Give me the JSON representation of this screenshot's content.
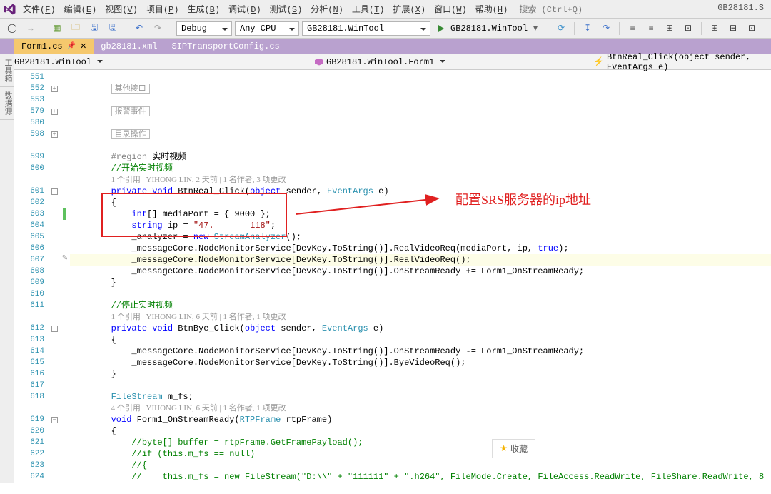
{
  "menubar": {
    "items": [
      "文件(F)",
      "编辑(E)",
      "视图(V)",
      "项目(P)",
      "生成(B)",
      "调试(D)",
      "测试(S)",
      "分析(N)",
      "工具(T)",
      "扩展(X)",
      "窗口(W)",
      "帮助(H)"
    ],
    "search_placeholder": "搜索 (Ctrl+Q)",
    "solution_title": "GB28181.S"
  },
  "toolbar": {
    "config": "Debug",
    "platform": "Any CPU",
    "startup": "GB28181.WinTool",
    "run": "GB28181.WinTool"
  },
  "tabs": [
    {
      "label": "Form1.cs",
      "active": true,
      "pinned": true
    },
    {
      "label": "gb28181.xml",
      "active": false
    },
    {
      "label": "SIPTransportConfig.cs",
      "active": false
    }
  ],
  "crumbs": {
    "left": "GB28181.WinTool",
    "center": "GB28181.WinTool.Form1",
    "right": "BtnReal_Click(object sender, EventArgs e)"
  },
  "sidetabs": [
    "工具箱",
    "数据源"
  ],
  "code": {
    "lines": [
      {
        "n": "551",
        "fold": "",
        "t": "                "
      },
      {
        "n": "552",
        "fold": "box+",
        "t": "        <span class='bx'>其他接口</span>"
      },
      {
        "n": "553",
        "fold": "",
        "t": ""
      },
      {
        "n": "579",
        "fold": "box+",
        "t": "        <span class='bx'>报警事件</span>"
      },
      {
        "n": "580",
        "fold": "",
        "t": ""
      },
      {
        "n": "598",
        "fold": "box+",
        "t": "        <span class='bx'>目录操作</span>"
      },
      {
        "n": "",
        "fold": "",
        "t": ""
      },
      {
        "n": "599",
        "fold": "",
        "t": "        <span class='reg'>#region</span> 实时视频"
      },
      {
        "n": "600",
        "fold": "",
        "t": "        <span class='cm'>//开始实时视频</span>"
      },
      {
        "n": "",
        "fold": "",
        "t": "        <span class='ref'>1 个引用 | YIHONG LIN, 2 天前 | 1 名作者, 3 项更改</span>"
      },
      {
        "n": "601",
        "fold": "box-",
        "t": "        <span class='kw'>private</span> <span class='kw'>void</span> BtnReal_Click(<span class='kw'>object</span> sender, <span class='tp'>EventArgs</span> e)"
      },
      {
        "n": "602",
        "fold": "",
        "t": "        {"
      },
      {
        "n": "603",
        "fold": "",
        "ind": "green",
        "t": "            <span class='kw'>int</span>[] mediaPort = { 9000 };"
      },
      {
        "n": "604",
        "fold": "",
        "t": "            <span class='kw'>string</span> ip = <span class='str'>\"47.       118\"</span>;"
      },
      {
        "n": "605",
        "fold": "",
        "t": "            _analyzer = <span class='kw'>new</span> <span class='tp'>StreamAnalyzer</span>();"
      },
      {
        "n": "606",
        "fold": "",
        "t": "            _messageCore.NodeMonitorService[DevKey.ToString()].RealVideoReq(mediaPort, ip, <span class='kw'>true</span>);"
      },
      {
        "n": "607",
        "fold": "",
        "ind": "pencil",
        "hl": true,
        "t": "            _messageCore.NodeMonitorService[DevKey.ToString()].RealVideoReq();"
      },
      {
        "n": "608",
        "fold": "",
        "t": "            _messageCore.NodeMonitorService[DevKey.ToString()].OnStreamReady += Form1_OnStreamReady;"
      },
      {
        "n": "609",
        "fold": "",
        "t": "        }"
      },
      {
        "n": "610",
        "fold": "",
        "t": ""
      },
      {
        "n": "611",
        "fold": "",
        "t": "        <span class='cm'>//停止实时视频</span>"
      },
      {
        "n": "",
        "fold": "",
        "t": "        <span class='ref'>1 个引用 | YIHONG LIN, 6 天前 | 1 名作者, 1 项更改</span>"
      },
      {
        "n": "612",
        "fold": "box-",
        "t": "        <span class='kw'>private</span> <span class='kw'>void</span> BtnBye_Click(<span class='kw'>object</span> sender, <span class='tp'>EventArgs</span> e)"
      },
      {
        "n": "613",
        "fold": "",
        "t": "        {"
      },
      {
        "n": "614",
        "fold": "",
        "t": "            _messageCore.NodeMonitorService[DevKey.ToString()].OnStreamReady -= Form1_OnStreamReady;"
      },
      {
        "n": "615",
        "fold": "",
        "t": "            _messageCore.NodeMonitorService[DevKey.ToString()].ByeVideoReq();"
      },
      {
        "n": "616",
        "fold": "",
        "t": "        }"
      },
      {
        "n": "617",
        "fold": "",
        "t": ""
      },
      {
        "n": "618",
        "fold": "",
        "t": "        <span class='tp'>FileStream</span> m_fs;"
      },
      {
        "n": "",
        "fold": "",
        "t": "        <span class='ref'>4 个引用 | YIHONG LIN, 6 天前 | 1 名作者, 1 项更改</span>"
      },
      {
        "n": "619",
        "fold": "box-",
        "t": "        <span class='kw'>void</span> Form1_OnStreamReady(<span class='tp'>RTPFrame</span> rtpFrame)"
      },
      {
        "n": "620",
        "fold": "",
        "t": "        {"
      },
      {
        "n": "621",
        "fold": "",
        "t": "            <span class='cm'>//byte[] buffer = rtpFrame.GetFramePayload();</span>"
      },
      {
        "n": "622",
        "fold": "",
        "t": "            <span class='cm'>//if (this.m_fs == null)</span>"
      },
      {
        "n": "623",
        "fold": "",
        "t": "            <span class='cm'>//{</span>"
      },
      {
        "n": "624",
        "fold": "",
        "t": "            <span class='cm'>//    this.m_fs = new FileStream(\"D:\\\\\" + \"111111\" + \".h264\", FileMode.Create, FileAccess.ReadWrite, FileShare.ReadWrite, 8</span>"
      },
      {
        "n": "",
        "fold": "",
        "t": ""
      }
    ]
  },
  "annotation": "配置SRS服务器的ip地址",
  "bookmark": "收藏"
}
